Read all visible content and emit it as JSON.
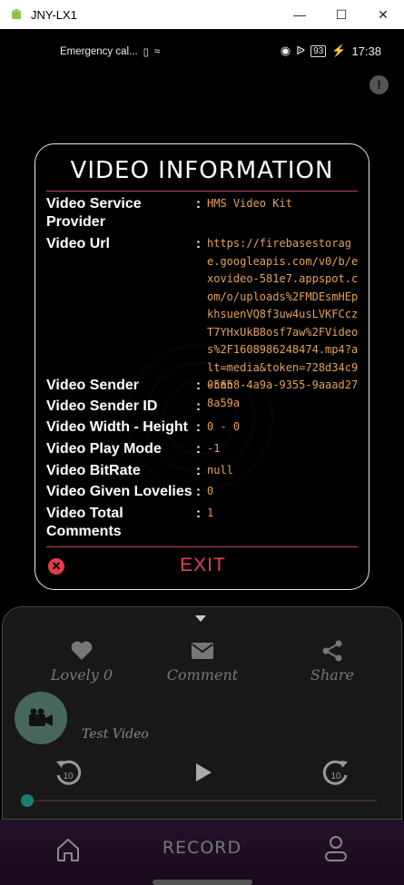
{
  "window": {
    "title": "JNY-LX1"
  },
  "status_bar": {
    "left_text": "Emergency cal...",
    "battery": "93",
    "time": "17:38"
  },
  "dialog": {
    "title": "VIDEO INFORMATION",
    "rows": [
      {
        "label": "Video Service Provider",
        "value": "HMS Video Kit"
      },
      {
        "label": "Video Url",
        "value": "https://firebasestorage.googleapis.com/v0/b/exovideo-581e7.appspot.com/o/uploads%2FMDEsmHEpkhsuenVQ8f3uw4usLVKFCczT7YHxUkB8osf7aw%2FVideos%2F1608986248474.mp4?alt=media&token=728d34c9-5658-4a9a-9355-9aaad278a59a"
      },
      {
        "label": "Video Sender",
        "value": "0can"
      },
      {
        "label": "Video Sender ID",
        "value": ""
      },
      {
        "label": "Video Width - Height",
        "value": "0 - 0"
      },
      {
        "label": "Video Play Mode",
        "value": "-1"
      },
      {
        "label": "Video BitRate",
        "value": "null"
      },
      {
        "label": "Video Given Lovelies",
        "value": "0"
      },
      {
        "label": "Video Total Comments",
        "value": "1"
      }
    ],
    "exit_label": "EXIT"
  },
  "player": {
    "actions": {
      "lovely": "Lovely 0",
      "comment": "Comment",
      "share": "Share"
    },
    "video_title": "Test Video",
    "rewind_label": "10",
    "forward_label": "10",
    "progress": 0.0
  },
  "nav": {
    "record_label": "RECORD"
  },
  "colors": {
    "accent": "#e24352",
    "value": "#e4a15a",
    "divider": "#c0485f"
  }
}
